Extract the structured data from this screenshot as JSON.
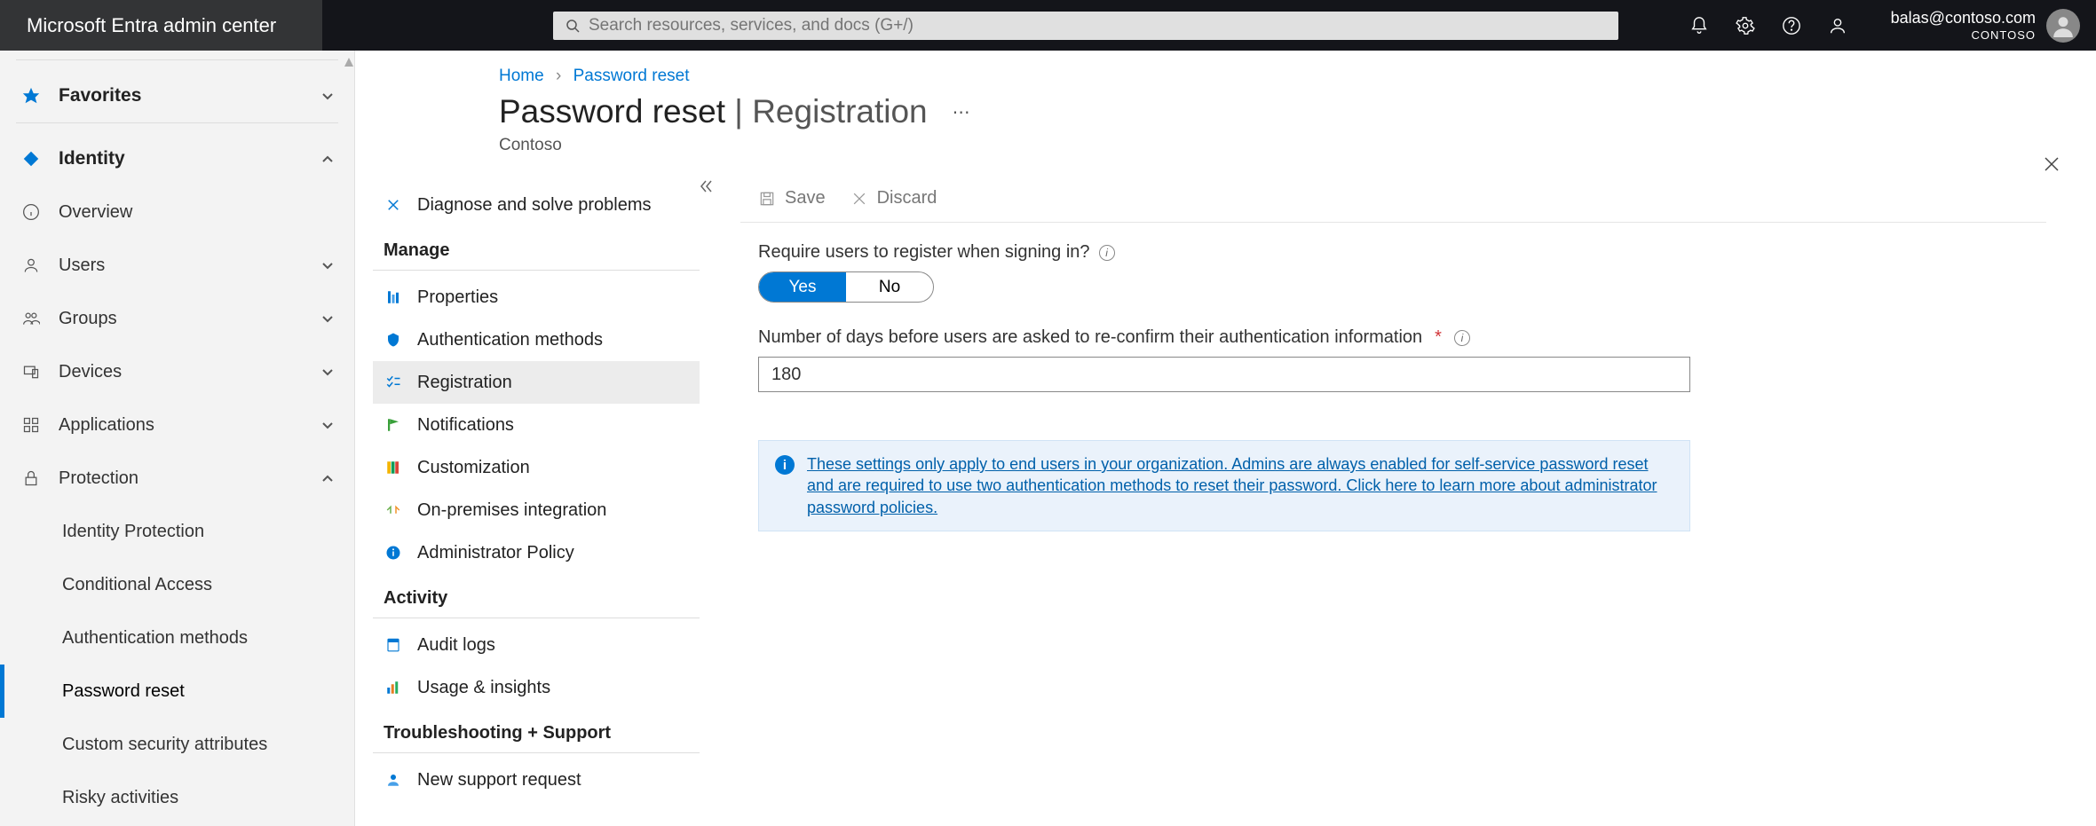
{
  "header": {
    "app_title": "Microsoft Entra admin center",
    "search_placeholder": "Search resources, services, and docs (G+/)",
    "user_email": "balas@contoso.com",
    "user_org": "CONTOSO"
  },
  "leftnav": {
    "favorites_label": "Favorites",
    "identity_label": "Identity",
    "items": [
      {
        "label": "Overview"
      },
      {
        "label": "Users"
      },
      {
        "label": "Groups"
      },
      {
        "label": "Devices"
      },
      {
        "label": "Applications"
      },
      {
        "label": "Protection"
      }
    ],
    "protection_sub": [
      {
        "label": "Identity Protection"
      },
      {
        "label": "Conditional Access"
      },
      {
        "label": "Authentication methods"
      },
      {
        "label": "Password reset"
      },
      {
        "label": "Custom security attributes"
      },
      {
        "label": "Risky activities"
      }
    ]
  },
  "secnav": {
    "diagnose": "Diagnose and solve problems",
    "manage_hdr": "Manage",
    "manage": [
      {
        "label": "Properties"
      },
      {
        "label": "Authentication methods"
      },
      {
        "label": "Registration"
      },
      {
        "label": "Notifications"
      },
      {
        "label": "Customization"
      },
      {
        "label": "On-premises integration"
      },
      {
        "label": "Administrator Policy"
      }
    ],
    "activity_hdr": "Activity",
    "activity": [
      {
        "label": "Audit logs"
      },
      {
        "label": "Usage & insights"
      }
    ],
    "trouble_hdr": "Troubleshooting + Support",
    "trouble": [
      {
        "label": "New support request"
      }
    ]
  },
  "breadcrumb": {
    "home": "Home",
    "page": "Password reset"
  },
  "page": {
    "title_main": "Password reset",
    "title_sub": "Registration",
    "org": "Contoso"
  },
  "cmdbar": {
    "save": "Save",
    "discard": "Discard"
  },
  "form": {
    "require_label": "Require users to register when signing in?",
    "yes": "Yes",
    "no": "No",
    "days_label": "Number of days before users are asked to re-confirm their authentication information",
    "days_value": "180",
    "info_text": "These settings only apply to end users in your organization. Admins are always enabled for self-service password reset and are required to use two authentication methods to reset their password. Click here to learn more about administrator password policies."
  }
}
